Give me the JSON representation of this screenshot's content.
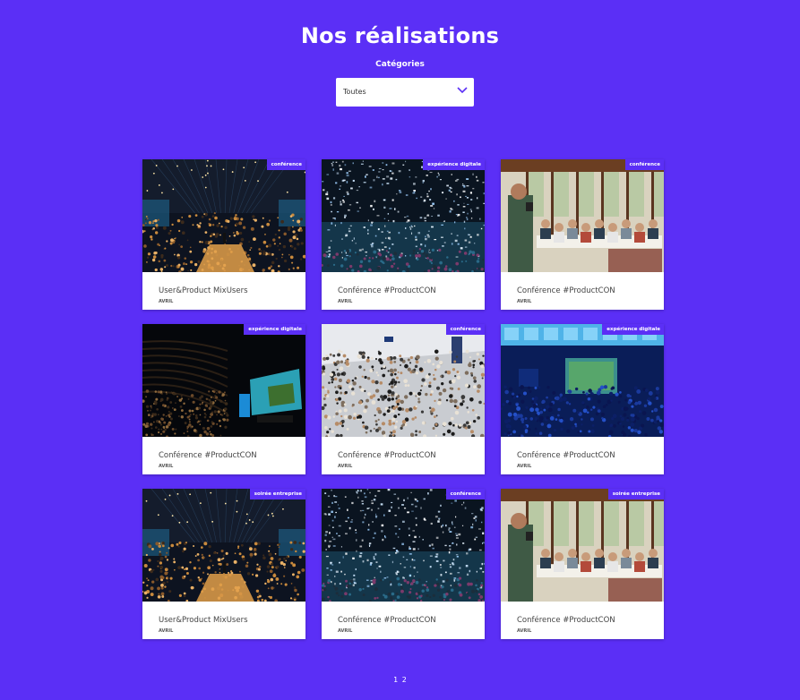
{
  "page": {
    "title": "Nos réalisations"
  },
  "filter": {
    "label": "Catégories",
    "selected": "Toutes"
  },
  "cards": [
    {
      "badge": "conférence",
      "title": "User&Product MixUsers",
      "date": "AVRIL",
      "image": "concert-stage-icon"
    },
    {
      "badge": "expérience digitale",
      "title": "Conférence #ProductCON",
      "date": "AVRIL",
      "image": "confetti-crowd-icon"
    },
    {
      "badge": "conférence",
      "title": "Conférence #ProductCON",
      "date": "AVRIL",
      "image": "restaurant-speaker-icon"
    },
    {
      "badge": "expérience digitale",
      "title": "Conférence #ProductCON",
      "date": "AVRIL",
      "image": "auditorium-screen-icon"
    },
    {
      "badge": "conférence",
      "title": "Conférence #ProductCON",
      "date": "AVRIL",
      "image": "crowd-hall-icon"
    },
    {
      "badge": "expérience digitale",
      "title": "Conférence #ProductCON",
      "date": "AVRIL",
      "image": "blue-room-screen-icon"
    },
    {
      "badge": "soirée entreprise",
      "title": "User&Product MixUsers",
      "date": "AVRIL",
      "image": "concert-stage-icon"
    },
    {
      "badge": "conférence",
      "title": "Conférence #ProductCON",
      "date": "AVRIL",
      "image": "confetti-crowd-icon"
    },
    {
      "badge": "soirée entreprise",
      "title": "Conférence #ProductCON",
      "date": "AVRIL",
      "image": "restaurant-speaker-icon"
    }
  ],
  "pagination": {
    "pages": [
      "1",
      "2"
    ]
  },
  "colors": {
    "background": "#5b2ff6",
    "badge": "#5b2ff6",
    "card": "#ffffff"
  }
}
